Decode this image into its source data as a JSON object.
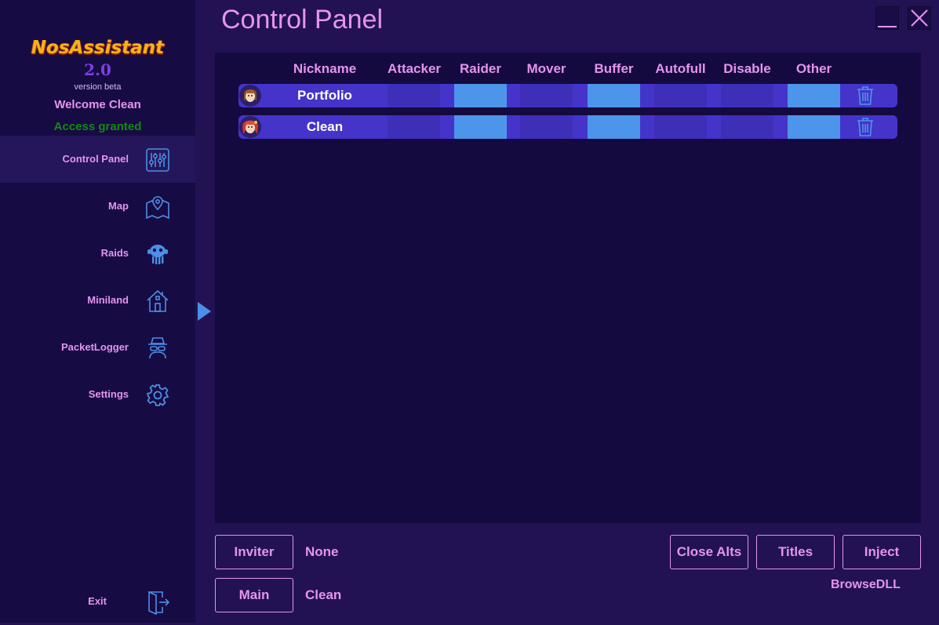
{
  "sidebar": {
    "logo_text": "NosAssistant",
    "logo_version": "2.0",
    "version_label": "version beta",
    "welcome": "Welcome Clean",
    "access": "Access granted",
    "items": [
      {
        "label": "Control Panel",
        "icon": "sliders-icon",
        "active": true
      },
      {
        "label": "Map",
        "icon": "map-pin-icon"
      },
      {
        "label": "Raids",
        "icon": "monster-icon"
      },
      {
        "label": "Miniland",
        "icon": "house-icon"
      },
      {
        "label": "PacketLogger",
        "icon": "spy-icon"
      },
      {
        "label": "Settings",
        "icon": "gear-icon"
      }
    ],
    "exit_label": "Exit"
  },
  "header": {
    "title": "Control Panel"
  },
  "table": {
    "columns": [
      "Nickname",
      "Attacker",
      "Raider",
      "Mover",
      "Buffer",
      "Autofull",
      "Disable",
      "Other"
    ],
    "rows": [
      {
        "nickname": "Portfolio",
        "attacker": false,
        "raider": true,
        "mover": false,
        "buffer": true,
        "autofull": false,
        "disable": false,
        "other": true
      },
      {
        "nickname": "Clean",
        "attacker": false,
        "raider": true,
        "mover": false,
        "buffer": true,
        "autofull": false,
        "disable": false,
        "other": true
      }
    ]
  },
  "bottom": {
    "inviter_button": "Inviter",
    "inviter_value": "None",
    "main_button": "Main",
    "main_value": "Clean",
    "close_alts_button": "Close Alts",
    "titles_button": "Titles",
    "inject_button": "Inject",
    "browse_dll": "BrowseDLL"
  },
  "colors": {
    "accent": "#e594ec",
    "toggle_on": "#4d95ea",
    "toggle_off": "#3e2fb8",
    "row_bg": "#4434c9",
    "access_green": "#0f8a12"
  }
}
